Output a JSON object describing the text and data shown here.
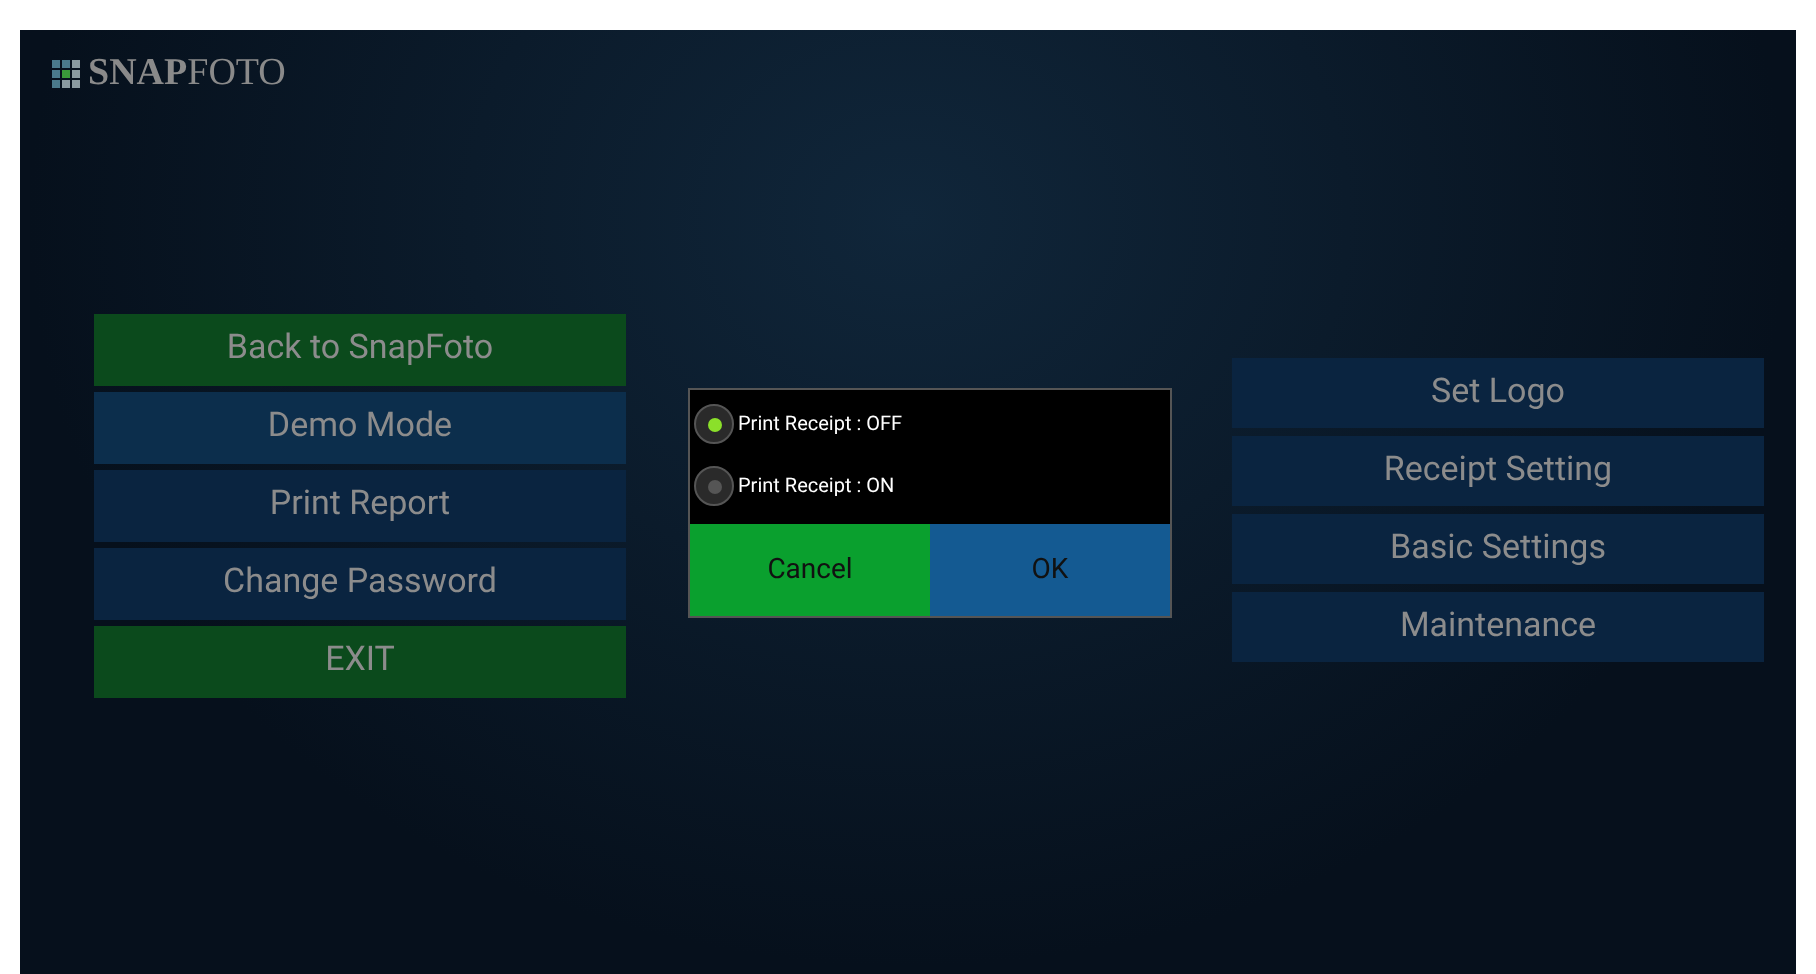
{
  "logo": {
    "text": "**SNAP**FOTO"
  },
  "left_menu": [
    {
      "label": "Back to SnapFoto",
      "color": "#0b4a1c"
    },
    {
      "label": "Demo Mode",
      "color": "#0c2e4c"
    },
    {
      "label": "Print Report",
      "color": "#0a2440"
    },
    {
      "label": "Change Password",
      "color": "#0a2440"
    },
    {
      "label": "EXIT",
      "color": "#0b4a1c"
    }
  ],
  "dialog": {
    "options": [
      {
        "label": "Print Receipt : OFF",
        "selected": true
      },
      {
        "label": "Print Receipt : ON",
        "selected": false
      }
    ],
    "buttons": [
      {
        "label": "Cancel",
        "kind": "cancel"
      },
      {
        "label": "OK",
        "kind": "ok"
      }
    ]
  },
  "right_menu": [
    {
      "label": "Set Logo"
    },
    {
      "label": "Receipt Setting"
    },
    {
      "label": "Basic Settings"
    },
    {
      "label": "Maintenance"
    }
  ]
}
